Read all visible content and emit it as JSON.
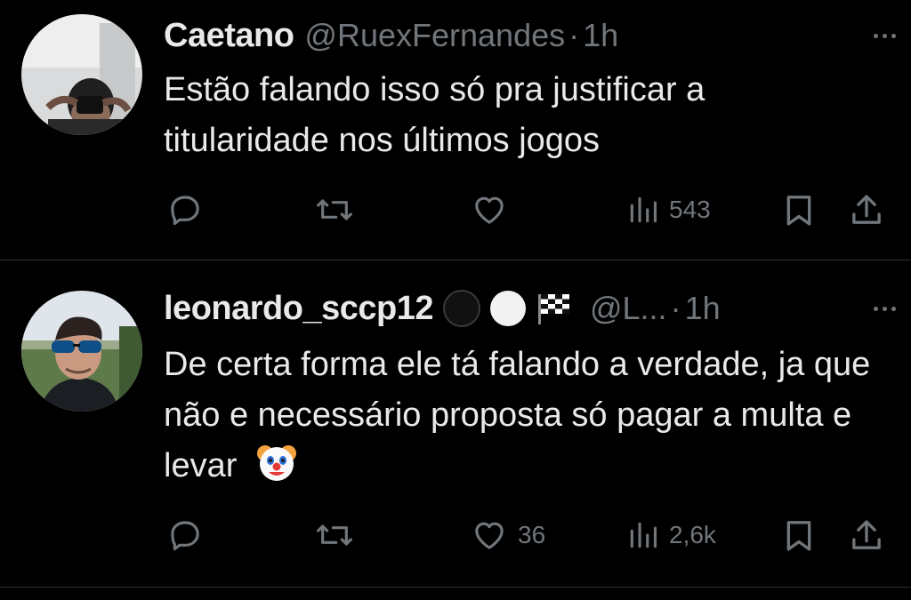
{
  "tweets": [
    {
      "name": "Caetano",
      "handle": "@RuexFernandes",
      "dot": "·",
      "time": "1h",
      "text": "Estão falando isso só pra justificar a titularidade nos últimos jogos",
      "metrics": {
        "reply": "",
        "retweet": "",
        "like": "",
        "views": "543"
      },
      "avatar_icon": "avatar-caetano"
    },
    {
      "name": "leonardo_sccp12",
      "handle": "@L...",
      "dot": "·",
      "time": "1h",
      "name_emojis": [
        "black-circle-emoji",
        "white-circle-emoji",
        "chequered-flag-emoji"
      ],
      "text": "De certa forma ele tá falando a verdade, ja que não e necessário proposta só pagar a multa e levar",
      "text_emoji": "clown-face-emoji",
      "metrics": {
        "reply": "",
        "retweet": "",
        "like": "36",
        "views": "2,6k"
      },
      "avatar_icon": "avatar-leonardo"
    }
  ],
  "colors": {
    "background": "#000000",
    "primary_text": "#e7e9ea",
    "secondary_text": "#71767b",
    "divider": "#2f3336"
  }
}
